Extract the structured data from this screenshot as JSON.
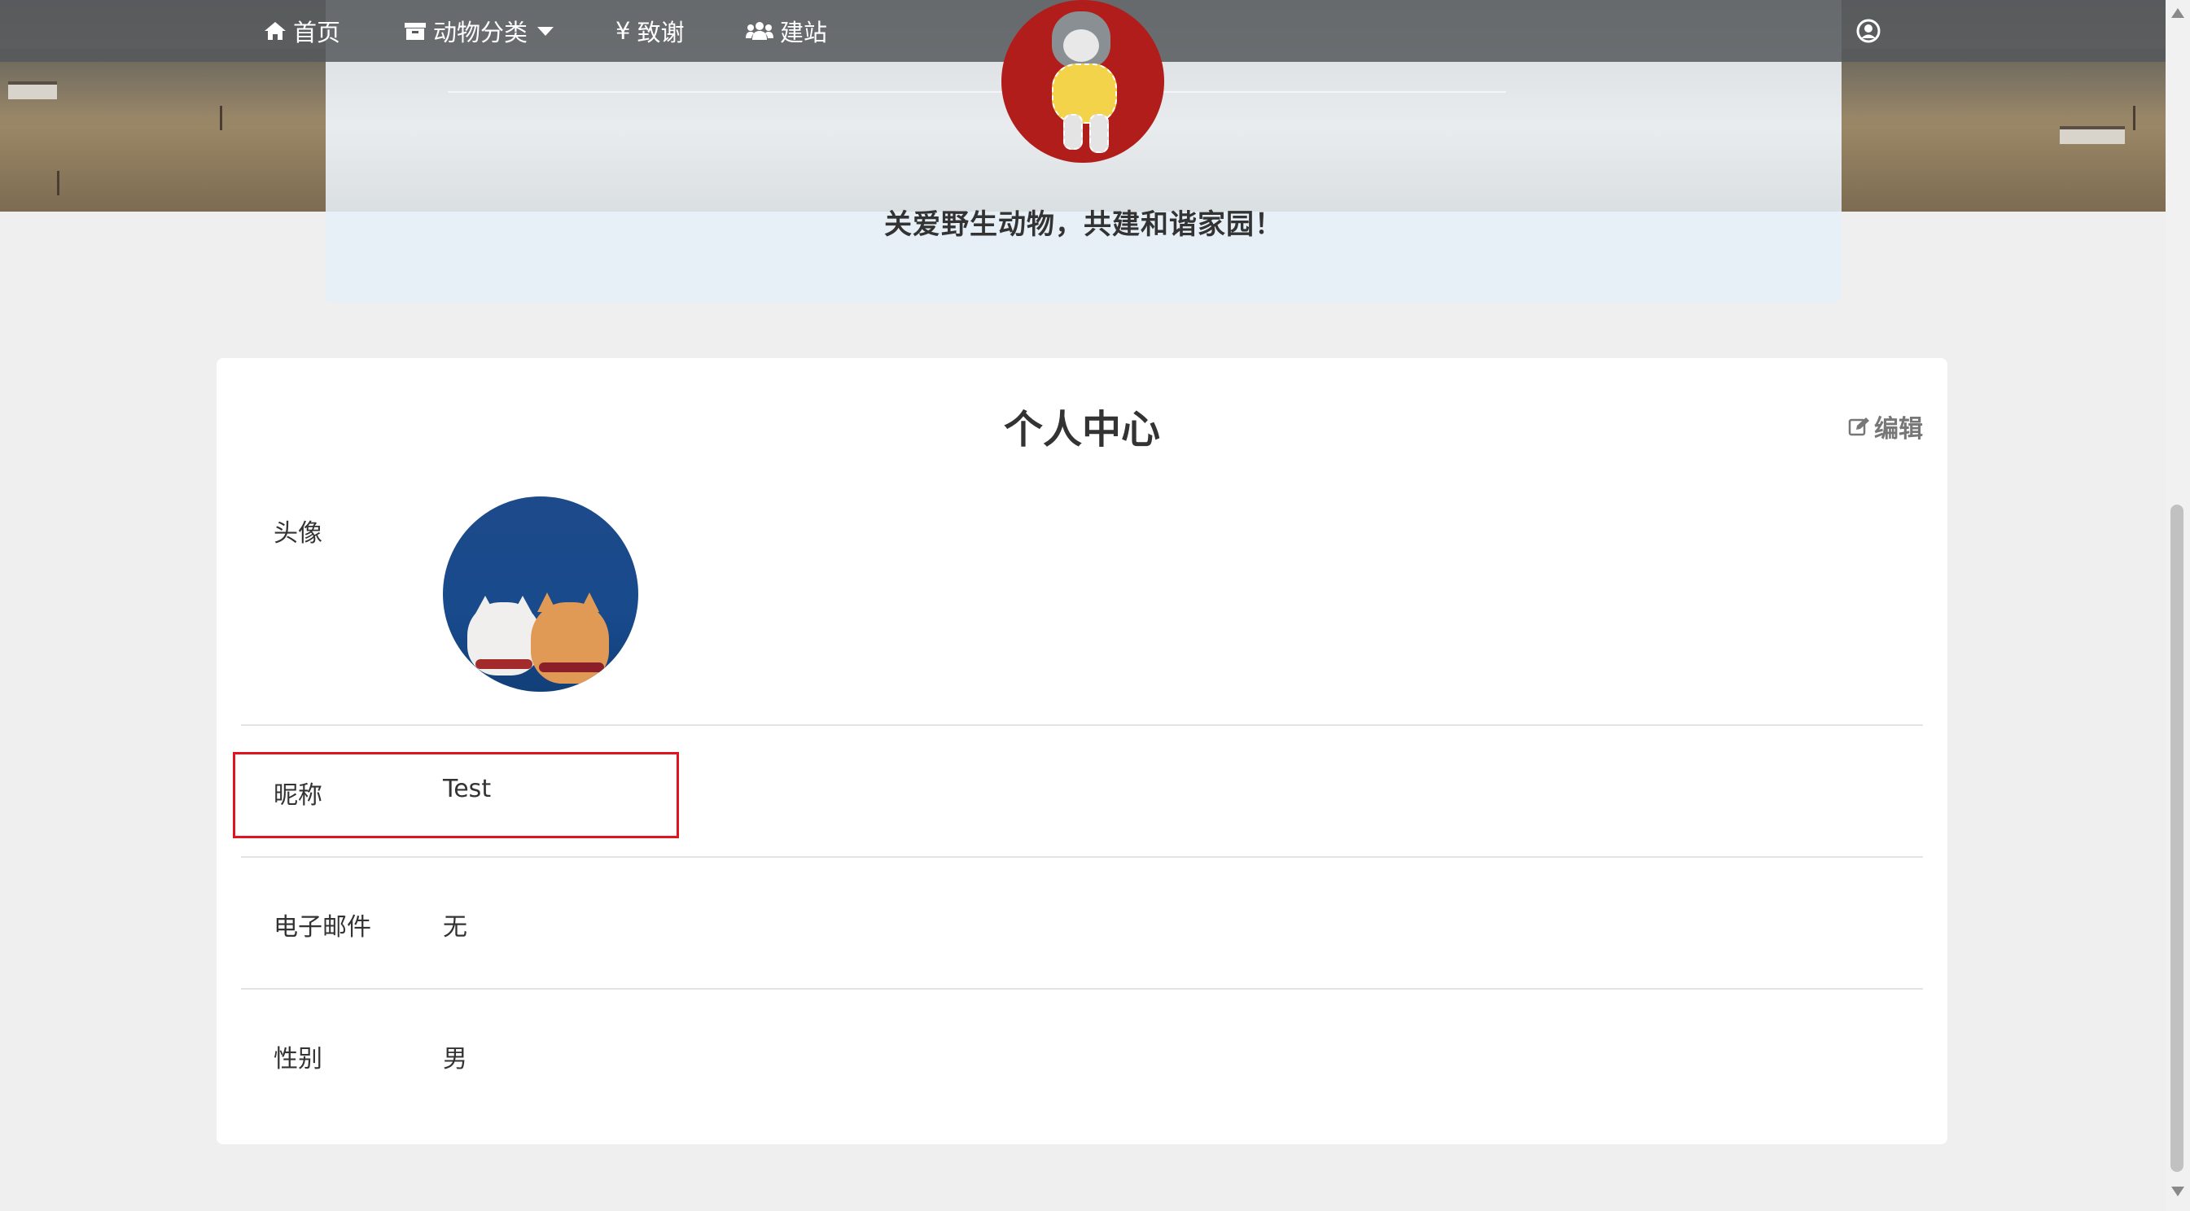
{
  "nav": {
    "home": {
      "label": "首页",
      "icon": "home-icon"
    },
    "category": {
      "label": "动物分类",
      "icon": "archive-icon"
    },
    "thanks": {
      "label": "致谢",
      "icon": "yen-icon",
      "prefix": "¥"
    },
    "build": {
      "label": "建站",
      "icon": "users-icon"
    },
    "user_icon": "user-circle-icon"
  },
  "header": {
    "slogan": "关爱野生动物，共建和谐家园！"
  },
  "profile": {
    "title": "个人中心",
    "edit_label": "编辑",
    "fields": [
      {
        "label": "头像",
        "value": ""
      },
      {
        "label": "昵称",
        "value": "Test"
      },
      {
        "label": "电子邮件",
        "value": "无"
      },
      {
        "label": "性别",
        "value": "男"
      }
    ]
  },
  "colors": {
    "highlight": "#e0141e",
    "logo_bg": "#b11d1a",
    "avatar_bg": "#184a8c"
  }
}
